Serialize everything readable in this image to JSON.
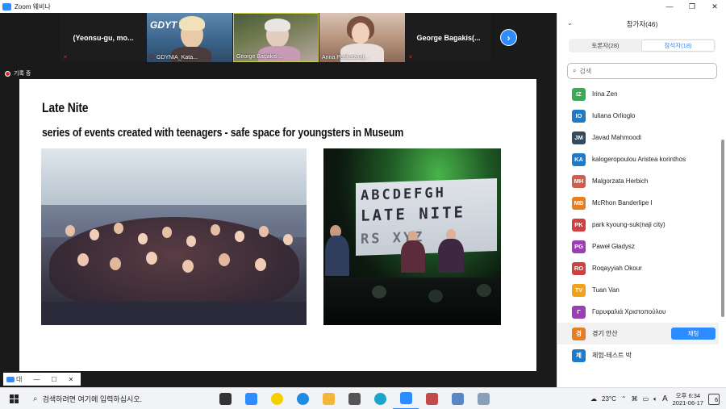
{
  "window": {
    "title": "Zoom 웨비나",
    "min_icon": "minimize-icon",
    "max_icon": "maximize-icon",
    "close_icon": "close-icon"
  },
  "video_strip": {
    "tiles": [
      {
        "name": "(Yeonsu-gu,  mo...",
        "type": "name-only"
      },
      {
        "name": "GDYNIA_Kata...",
        "type": "video",
        "logo": "GDYT"
      },
      {
        "name": "George Bagakis ...",
        "type": "video"
      },
      {
        "name": "Anna Posłuszna(...",
        "type": "video"
      },
      {
        "name": "George Bagakis(...",
        "type": "name-only"
      }
    ],
    "next_icon": "chevron-right-icon"
  },
  "recording": {
    "label": "기록 중"
  },
  "slide": {
    "title": "Late Nite",
    "subtitle": "series of events created with teenagers - safe space for youngsters in Museum",
    "banner_line1": "ABCDEFGH",
    "banner_line2": "LATE NITE",
    "banner_line3": "RS    XYZ"
  },
  "mini_controls": {
    "label": "대"
  },
  "panel": {
    "header": "참가자(46)",
    "tabs": [
      {
        "label": "토론자(28)",
        "active": false
      },
      {
        "label": "참석자(18)",
        "active": true
      }
    ],
    "search_placeholder": "검색",
    "chat_label": "채팅",
    "participants": [
      {
        "initials": "IZ",
        "name": "Irina Zen",
        "color": "#3aaa55"
      },
      {
        "initials": "IO",
        "name": "Iuliana Orlioglo",
        "color": "#1f7ac8"
      },
      {
        "initials": "JM",
        "name": "Javad Mahmoodi",
        "color": "#34495e"
      },
      {
        "initials": "KA",
        "name": "kalogeropoulou Aristea korinthos",
        "color": "#1f7ac8"
      },
      {
        "initials": "MH",
        "name": "Malgorzata Herbich",
        "color": "#d35d4a"
      },
      {
        "initials": "MB",
        "name": "McRhon Banderlipe I",
        "color": "#e67e22"
      },
      {
        "initials": "PK",
        "name": "park kyoung-suk(naji city)",
        "color": "#d14040"
      },
      {
        "initials": "PG",
        "name": "Paweł Gładysz",
        "color": "#9b3fb5"
      },
      {
        "initials": "RO",
        "name": "Roqayyiah Okour",
        "color": "#d14040"
      },
      {
        "initials": "TV",
        "name": "Tuan Van",
        "color": "#f0a21c"
      },
      {
        "initials": "Γ",
        "name": "Γαρυφαλιά Χριστοπούλου",
        "color": "#9b3fb5"
      },
      {
        "initials": "경",
        "name": "경기 안산",
        "color": "#e67e22",
        "highlight": true
      },
      {
        "initials": "체",
        "name": "체험-테스트 박",
        "color": "#1f7ac8"
      }
    ]
  },
  "taskbar": {
    "search_text": "검색하려면 여기에 입력하십시오.",
    "pinned": [
      {
        "name": "task-view-icon",
        "color": "#333"
      },
      {
        "name": "files-icon",
        "color": "#2d8cff"
      },
      {
        "name": "kakaotalk-icon",
        "color": "#f5d000"
      },
      {
        "name": "ie-icon",
        "color": "#1f8ce3"
      },
      {
        "name": "folder-icon",
        "color": "#f2b73a"
      },
      {
        "name": "calculator-icon",
        "color": "#555"
      },
      {
        "name": "edge-icon",
        "color": "#1aa6c9"
      },
      {
        "name": "zoom-icon",
        "color": "#2d8cff",
        "active": true
      },
      {
        "name": "paint-icon",
        "color": "#c24a4a"
      },
      {
        "name": "app-icon",
        "color": "#5a86c6"
      },
      {
        "name": "tool-icon",
        "color": "#8aa0b8"
      }
    ],
    "weather": "23°C",
    "ime": "A",
    "time": "오후 6:34",
    "date": "2021-06-17",
    "notifications": "6"
  },
  "colors": {
    "zoom_blue": "#2d8cff",
    "dark_bg": "#1a1a1a",
    "mute_red": "#e02828"
  }
}
